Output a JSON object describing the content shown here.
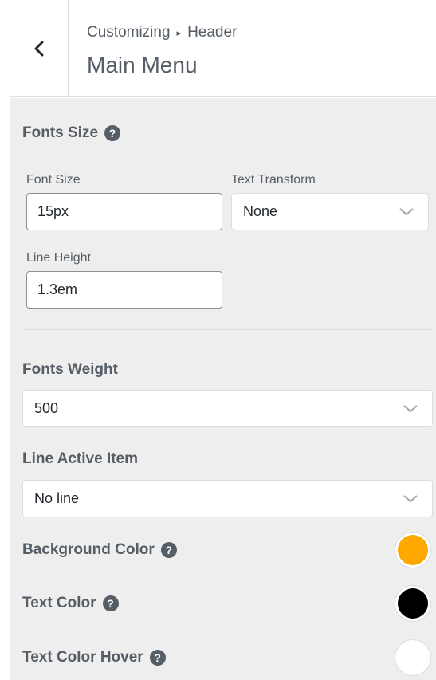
{
  "header": {
    "breadcrumb_root": "Customizing",
    "breadcrumb_current": "Header",
    "title": "Main Menu"
  },
  "fonts_size": {
    "title": "Fonts Size",
    "font_size_label": "Font Size",
    "font_size_value": "15px",
    "text_transform_label": "Text Transform",
    "text_transform_value": "None",
    "line_height_label": "Line Height",
    "line_height_value": "1.3em"
  },
  "fonts_weight": {
    "title": "Fonts Weight",
    "value": "500"
  },
  "line_active": {
    "title": "Line Active Item",
    "value": "No line"
  },
  "colors": {
    "background_label": "Background Color",
    "background_value": "#ffa800",
    "text_label": "Text Color",
    "text_value": "#000000",
    "text_hover_label": "Text Color Hover",
    "text_hover_value": "#ffffff"
  },
  "icons": {
    "help": "?"
  }
}
